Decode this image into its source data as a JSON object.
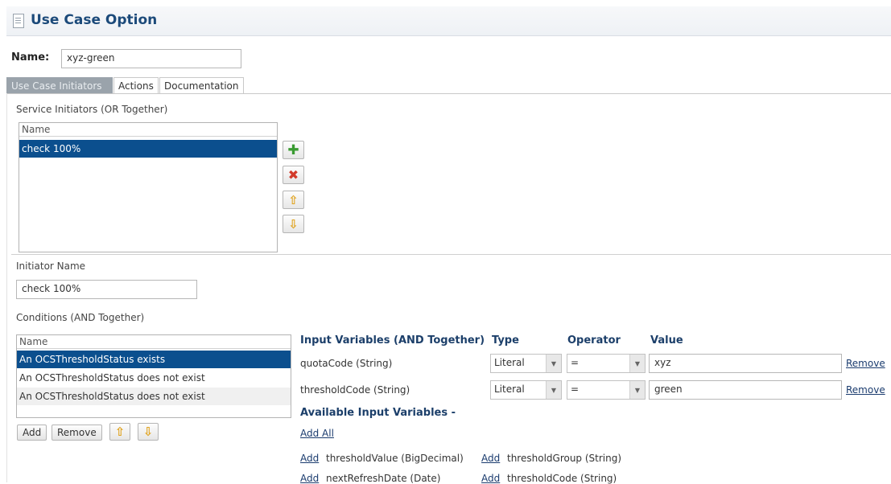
{
  "header": {
    "title": "Use Case Option",
    "icon": "document-icon"
  },
  "name": {
    "label": "Name:",
    "value": "xyz-green"
  },
  "tabs": [
    {
      "label": "Use Case Initiators",
      "active": true
    },
    {
      "label": "Actions",
      "active": false
    },
    {
      "label": "Documentation",
      "active": false
    }
  ],
  "service_initiators": {
    "label": "Service Initiators (OR Together)",
    "column": "Name",
    "rows": [
      "check 100%"
    ],
    "selected_index": 0
  },
  "initiator": {
    "label": "Initiator Name",
    "value": "check 100%"
  },
  "conditions": {
    "label": "Conditions (AND Together)",
    "column": "Name",
    "rows": [
      "An OCSThresholdStatus exists",
      "An OCSThresholdStatus does not exist",
      "An OCSThresholdStatus does not exist"
    ],
    "buttons": {
      "add": "Add",
      "remove": "Remove"
    }
  },
  "input_variables": {
    "headers": {
      "variables": "Input Variables (AND Together)",
      "type": "Type",
      "operator": "Operator",
      "value": "Value"
    },
    "rows": [
      {
        "name": "quotaCode (String)",
        "type": "Literal",
        "operator": "=",
        "value": "xyz",
        "remove": "Remove"
      },
      {
        "name": "thresholdCode (String)",
        "type": "Literal",
        "operator": "=",
        "value": "green",
        "remove": "Remove"
      }
    ]
  },
  "available": {
    "label": "Available Input Variables -",
    "add_all": "Add All",
    "add_label": "Add",
    "items": [
      "thresholdValue (BigDecimal)",
      "thresholdGroup (String)",
      "nextRefreshDate (Date)",
      "thresholdCode (String)"
    ]
  },
  "colors": {
    "title": "#1c4a7a",
    "selection": "#0b4f8e",
    "plus": "#3a9b32",
    "delete": "#d23a2a",
    "arrow": "#e0a31f"
  }
}
